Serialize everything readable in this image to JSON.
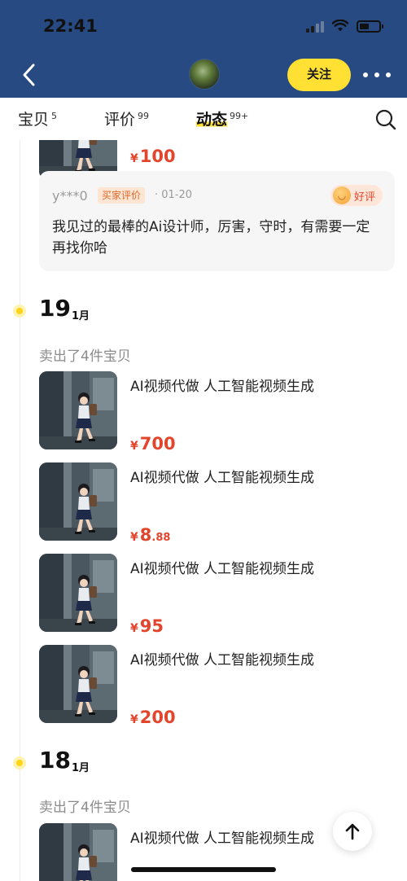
{
  "status_bar": {
    "time": "22:41"
  },
  "header": {
    "follow_label": "关注",
    "avatar_icon": "store-avatar-image",
    "back_icon": "chevron-left-icon",
    "more_icon": "more-dots-icon"
  },
  "tabs": [
    {
      "label": "宝贝",
      "count": "5"
    },
    {
      "label": "评价",
      "count": "99"
    },
    {
      "label": "动态",
      "count": "99+",
      "active": true
    }
  ],
  "top_item": {
    "price_currency": "¥",
    "price_int": "100",
    "price_dec": ""
  },
  "review": {
    "user": "y***0",
    "badge": "买家评价",
    "date": "· 01-20",
    "rating_label": "好评",
    "content": "我见过的最棒的Ai设计师，厉害，守时，有需要一定再找你哈"
  },
  "groups": [
    {
      "day": "19",
      "month": "1月",
      "summary": "卖出了4件宝贝",
      "items": [
        {
          "title": "AI视频代做 人工智能视频生成",
          "currency": "¥",
          "price_int": "700",
          "price_dec": ""
        },
        {
          "title": "AI视频代做 人工智能视频生成",
          "currency": "¥",
          "price_int": "8",
          "price_dec": ".88"
        },
        {
          "title": "AI视频代做 人工智能视频生成",
          "currency": "¥",
          "price_int": "95",
          "price_dec": ""
        },
        {
          "title": "AI视频代做 人工智能视频生成",
          "currency": "¥",
          "price_int": "200",
          "price_dec": ""
        }
      ]
    },
    {
      "day": "18",
      "month": "1月",
      "summary": "卖出了4件宝贝",
      "items": [
        {
          "title": "AI视频代做 人工智能视频生成"
        }
      ]
    }
  ],
  "colors": {
    "header_bg": "#274a82",
    "accent_yellow": "#ffe033",
    "price_red": "#e2452b"
  }
}
